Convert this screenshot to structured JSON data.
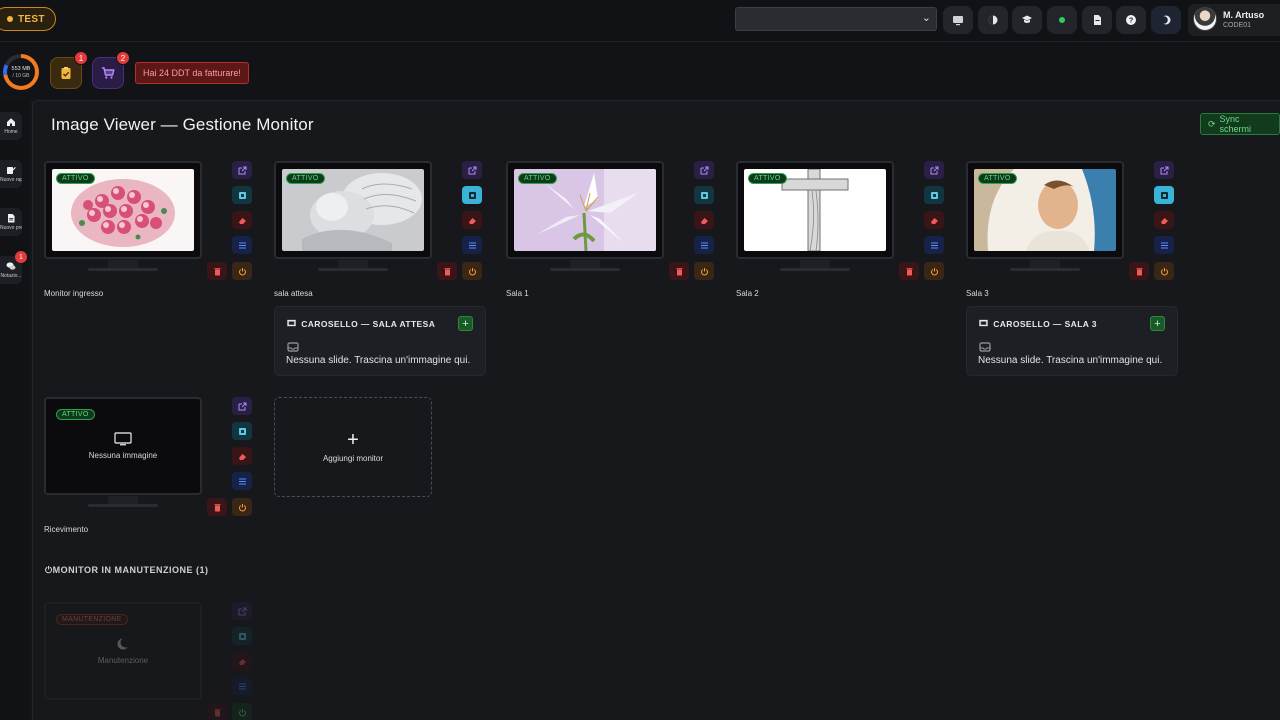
{
  "topbar": {
    "env_badge": "TEST",
    "select_value": "",
    "user": {
      "name": "M. Artuso",
      "code": "CODE01"
    },
    "icons": [
      "monitor-icon",
      "contrast-icon",
      "ticket-icon",
      "status-dot-icon",
      "document-icon",
      "help-icon",
      "theme-icon"
    ]
  },
  "stats": {
    "disk": {
      "used": "553 MB",
      "total": "/ 10 GB",
      "used_fraction": 0.72
    },
    "tasks_count": "1",
    "cart_count": "2",
    "alert": "Hai 24 DDT da fatturare!"
  },
  "sidebar": {
    "items": [
      {
        "label": "Home",
        "icon": "home-icon"
      },
      {
        "label": "Nuovo rap...",
        "icon": "edit-icon"
      },
      {
        "label": "Nuovo pre...",
        "icon": "document-icon"
      },
      {
        "label": "Notazio...",
        "icon": "chat-icon",
        "count": "1"
      }
    ]
  },
  "page": {
    "title": "Image Viewer — Gestione Monitor",
    "sync_label": "Sync schermi"
  },
  "monitors": [
    {
      "label": "Monitor ingresso",
      "status": "ATTIVO"
    },
    {
      "label": "sala attesa",
      "status": "ATTIVO"
    },
    {
      "label": "Sala 1",
      "status": "ATTIVO"
    },
    {
      "label": "Sala 2",
      "status": "ATTIVO"
    },
    {
      "label": "Sala 3",
      "status": "ATTIVO"
    },
    {
      "label": "Ricevimento",
      "status": "ATTIVO",
      "empty_text": "Nessuna immagine"
    }
  ],
  "carousels": [
    {
      "title": "CAROSELLO — SALA ATTESA",
      "empty": "Nessuna slide. Trascina un'immagine qui."
    },
    {
      "title": "CAROSELLO — SALA 3",
      "empty": "Nessuna slide. Trascina un'immagine qui."
    }
  ],
  "add_monitor_label": "Aggiungi monitor",
  "maintenance": {
    "heading": "MONITOR IN MANUTENZIONE (1)",
    "badge": "MANUTENZIONE",
    "text": "Manutenzione"
  },
  "colors": {
    "accent_green": "#2ca24a",
    "danger": "#e53a3a",
    "warning": "#f27b1f",
    "info": "#39b4d8"
  }
}
